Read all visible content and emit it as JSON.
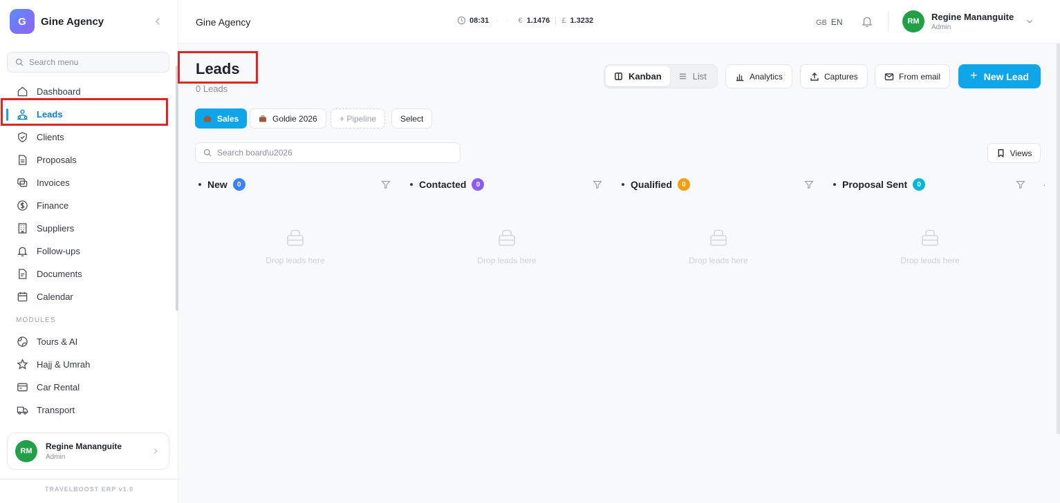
{
  "brand": {
    "logo_letter": "G",
    "name": "Gine Agency"
  },
  "sidebar": {
    "search_placeholder": "Search menu",
    "items": [
      {
        "label": "Dashboard",
        "icon": "home-icon"
      },
      {
        "label": "Leads",
        "icon": "users-icon",
        "active": true
      },
      {
        "label": "Clients",
        "icon": "shield-icon"
      },
      {
        "label": "Proposals",
        "icon": "file-icon"
      },
      {
        "label": "Invoices",
        "icon": "copy-icon"
      },
      {
        "label": "Finance",
        "icon": "dollar-circle-icon"
      },
      {
        "label": "Suppliers",
        "icon": "building-icon"
      },
      {
        "label": "Follow-ups",
        "icon": "bell-icon"
      },
      {
        "label": "Documents",
        "icon": "document-icon"
      },
      {
        "label": "Calendar",
        "icon": "calendar-icon"
      }
    ],
    "modules_label": "MODULES",
    "modules": [
      {
        "label": "Tours & AI",
        "icon": "globe-icon"
      },
      {
        "label": "Hajj & Umrah",
        "icon": "star-icon"
      },
      {
        "label": "Car Rental",
        "icon": "card-icon"
      },
      {
        "label": "Transport",
        "icon": "truck-icon"
      }
    ],
    "user": {
      "initials": "RM",
      "name": "Regine Mananguite",
      "role": "Admin"
    },
    "version": "TRAVELBOOST ERP v1.0"
  },
  "topbar": {
    "title": "Gine Agency",
    "time": "08:31",
    "dots": "· ·",
    "eur_symbol": "€",
    "eur_value": "1.1476",
    "gbp_symbol": "£",
    "gbp_value": "1.3232",
    "flag": "GB",
    "language": "EN",
    "user": {
      "initials": "RM",
      "name": "Regine Mananguite",
      "role": "Admin"
    }
  },
  "page": {
    "title": "Leads",
    "subtitle": "0 Leads",
    "view_toggle": {
      "kanban": "Kanban",
      "list": "List",
      "selected": "Kanban"
    },
    "actions": {
      "analytics": "Analytics",
      "captures": "Captures",
      "from_email": "From email",
      "new_lead": "New Lead"
    },
    "pipelines": {
      "sales": "Sales",
      "goldie": "Goldie 2026",
      "add": "+ Pipeline",
      "select": "Select"
    },
    "board_search_placeholder": "Search board\\u2026",
    "views": "Views",
    "columns": [
      {
        "name": "New",
        "count": "0",
        "color": "#3b82f6",
        "empty": "Drop leads here"
      },
      {
        "name": "Contacted",
        "count": "0",
        "color": "#8b5cf6",
        "empty": "Drop leads here"
      },
      {
        "name": "Qualified",
        "count": "0",
        "color": "#f59e0b",
        "empty": "Drop leads here"
      },
      {
        "name": "Proposal Sent",
        "count": "0",
        "color": "#06b6d4",
        "empty": "Drop leads here"
      }
    ]
  },
  "colors": {
    "accent": "#0ea5e9",
    "highlight": "#e02424",
    "avatar": "#22a047"
  }
}
